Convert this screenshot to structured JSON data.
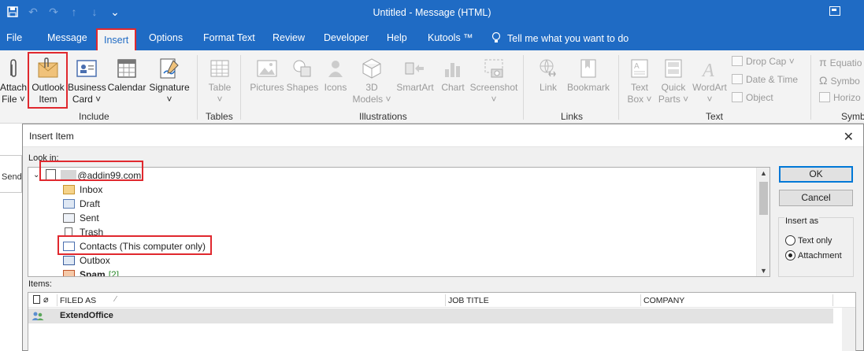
{
  "window": {
    "title": "Untitled  -  Message (HTML)"
  },
  "quick_access": [
    "save-icon",
    "undo-icon",
    "redo-icon",
    "up-arrow-icon",
    "down-arrow-icon",
    "customize-qat-icon"
  ],
  "menu": {
    "tabs": [
      "File",
      "Message",
      "Insert",
      "Options",
      "Format Text",
      "Review",
      "Developer",
      "Help",
      "Kutools ™"
    ],
    "active": "Insert",
    "tell_me": "Tell me what you want to do"
  },
  "ribbon": {
    "include": {
      "label": "Include",
      "attach_file": [
        "Attach",
        "File ˅"
      ],
      "outlook_item": [
        "Outlook",
        "Item"
      ],
      "business_card": [
        "Business",
        "Card ˅"
      ],
      "calendar": "Calendar",
      "signature": [
        "Signature",
        "˅"
      ]
    },
    "tables": {
      "label": "Tables",
      "table": [
        "Table",
        "˅"
      ]
    },
    "illustrations": {
      "label": "Illustrations",
      "pictures": "Pictures",
      "shapes": "Shapes",
      "icons": "Icons",
      "models": [
        "3D",
        "Models ˅"
      ],
      "smartart": "SmartArt",
      "chart": "Chart",
      "screenshot": [
        "Screenshot",
        "˅"
      ]
    },
    "links": {
      "label": "Links",
      "link": "Link",
      "bookmark": "Bookmark"
    },
    "text": {
      "label": "Text",
      "text_box": [
        "Text",
        "Box ˅"
      ],
      "quick_parts": [
        "Quick",
        "Parts ˅"
      ],
      "wordart": [
        "WordArt",
        "˅"
      ],
      "drop_cap": "Drop Cap ˅",
      "date_time": "Date & Time",
      "object": "Object"
    },
    "symbols": {
      "label": "Symb",
      "equation": "Equatio",
      "symbol": "Symbo",
      "horizontal": "Horizo"
    }
  },
  "behind": {
    "send": "Send"
  },
  "dialog": {
    "title": "Insert Item",
    "look_in_label": "Look in:",
    "account": "@addin99.com",
    "folders": [
      {
        "name": "Inbox",
        "icon": "inbox-icon"
      },
      {
        "name": "Draft",
        "icon": "draft-icon"
      },
      {
        "name": "Sent",
        "icon": "sent-icon"
      },
      {
        "name": "Trash",
        "icon": "trash-icon"
      },
      {
        "name": "Contacts (This computer only)",
        "icon": "contacts-icon"
      },
      {
        "name": "Outbox",
        "icon": "outbox-icon"
      },
      {
        "name": "Spam",
        "count": "[2]",
        "icon": "spam-icon"
      }
    ],
    "ok": "OK",
    "cancel": "Cancel",
    "insert_as": {
      "label": "Insert as",
      "options": [
        "Text only",
        "Attachment"
      ],
      "selected": "Attachment"
    },
    "items_label": "Items:",
    "columns": [
      "FILED AS",
      "JOB TITLE",
      "COMPANY"
    ],
    "rows": [
      {
        "filed_as": "ExtendOffice",
        "job_title": "",
        "company": ""
      }
    ]
  },
  "colors": {
    "accent": "#1f6bc4",
    "highlight": "#e0282e"
  }
}
